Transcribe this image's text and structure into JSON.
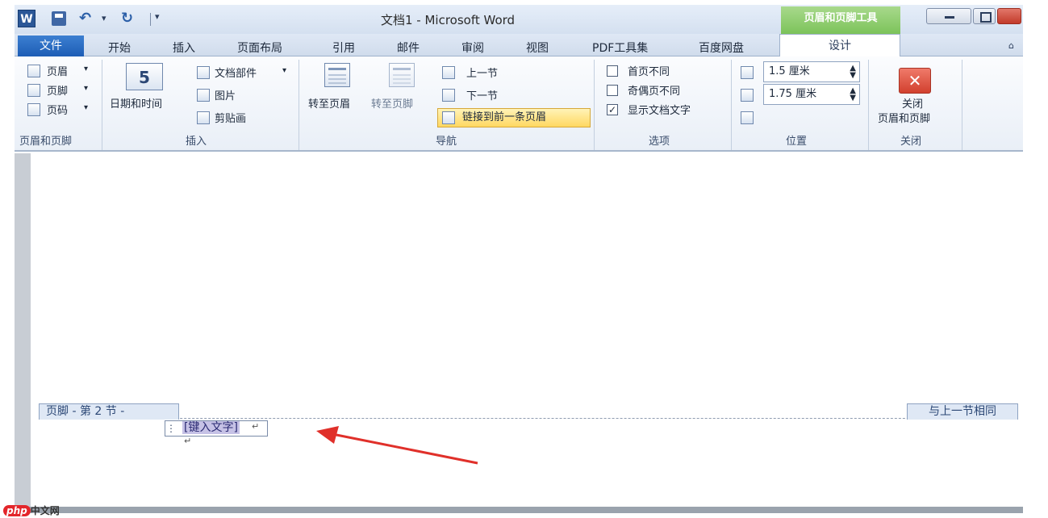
{
  "titlebar": {
    "word_icon": "W",
    "undo_glyph": "↶",
    "redo_glyph": "↻",
    "dropdown_glyph": "▾",
    "more_glyph": "▾",
    "title": "文档1 - Microsoft Word",
    "contextual_tab_group": "页眉和页脚工具"
  },
  "tabs": {
    "file": "文件",
    "items": [
      "开始",
      "插入",
      "页面布局",
      "引用",
      "邮件",
      "审阅",
      "视图",
      "PDF工具集",
      "百度网盘"
    ],
    "design": "设计",
    "minimize_glyph": "⌂"
  },
  "ribbon": {
    "group_header_footer": {
      "header": "页眉",
      "footer": "页脚",
      "page_number": "页码",
      "dropdown_glyph": "▾",
      "label": "页眉和页脚"
    },
    "group_insert": {
      "date_time": "日期和时间",
      "date_icon_text": "5",
      "doc_parts": "文档部件",
      "dropdown_glyph": "▾",
      "picture": "图片",
      "clip_art": "剪贴画",
      "label": "插入"
    },
    "group_navigation": {
      "goto_header": "转至页眉",
      "goto_footer": "转至页脚",
      "prev_section": "上一节",
      "next_section": "下一节",
      "link_to_previous": "链接到前一条页眉",
      "label": "导航"
    },
    "group_options": {
      "different_first_page": "首页不同",
      "different_odd_even": "奇偶页不同",
      "show_document_text": "显示文档文字",
      "show_document_text_checked": "✓",
      "label": "选项"
    },
    "group_position": {
      "header_from_top": "1.5 厘米",
      "footer_from_bottom": "1.75 厘米",
      "spin_glyph_up": "▲",
      "spin_glyph_down": "▼",
      "label": "位置"
    },
    "group_close": {
      "close_glyph": "✕",
      "close_line1": "关闭",
      "close_line2": "页眉和页脚",
      "label": "关闭"
    }
  },
  "document": {
    "footer_tag": "页脚 - 第 2 节 -",
    "same_as_previous": "与上一节相同",
    "footer_placeholder": "[键入文字]",
    "handle_glyph": "⋮",
    "para_mark": "↵",
    "cursor_mark": "↵"
  },
  "watermark": {
    "brand_pill": "php",
    "brand_text": "中文网"
  },
  "colors": {
    "accent": "#1d5db5",
    "contextual_green": "#7cc35a",
    "arrow_red": "#e0302a",
    "highlight_yellow": "#ffd861"
  }
}
